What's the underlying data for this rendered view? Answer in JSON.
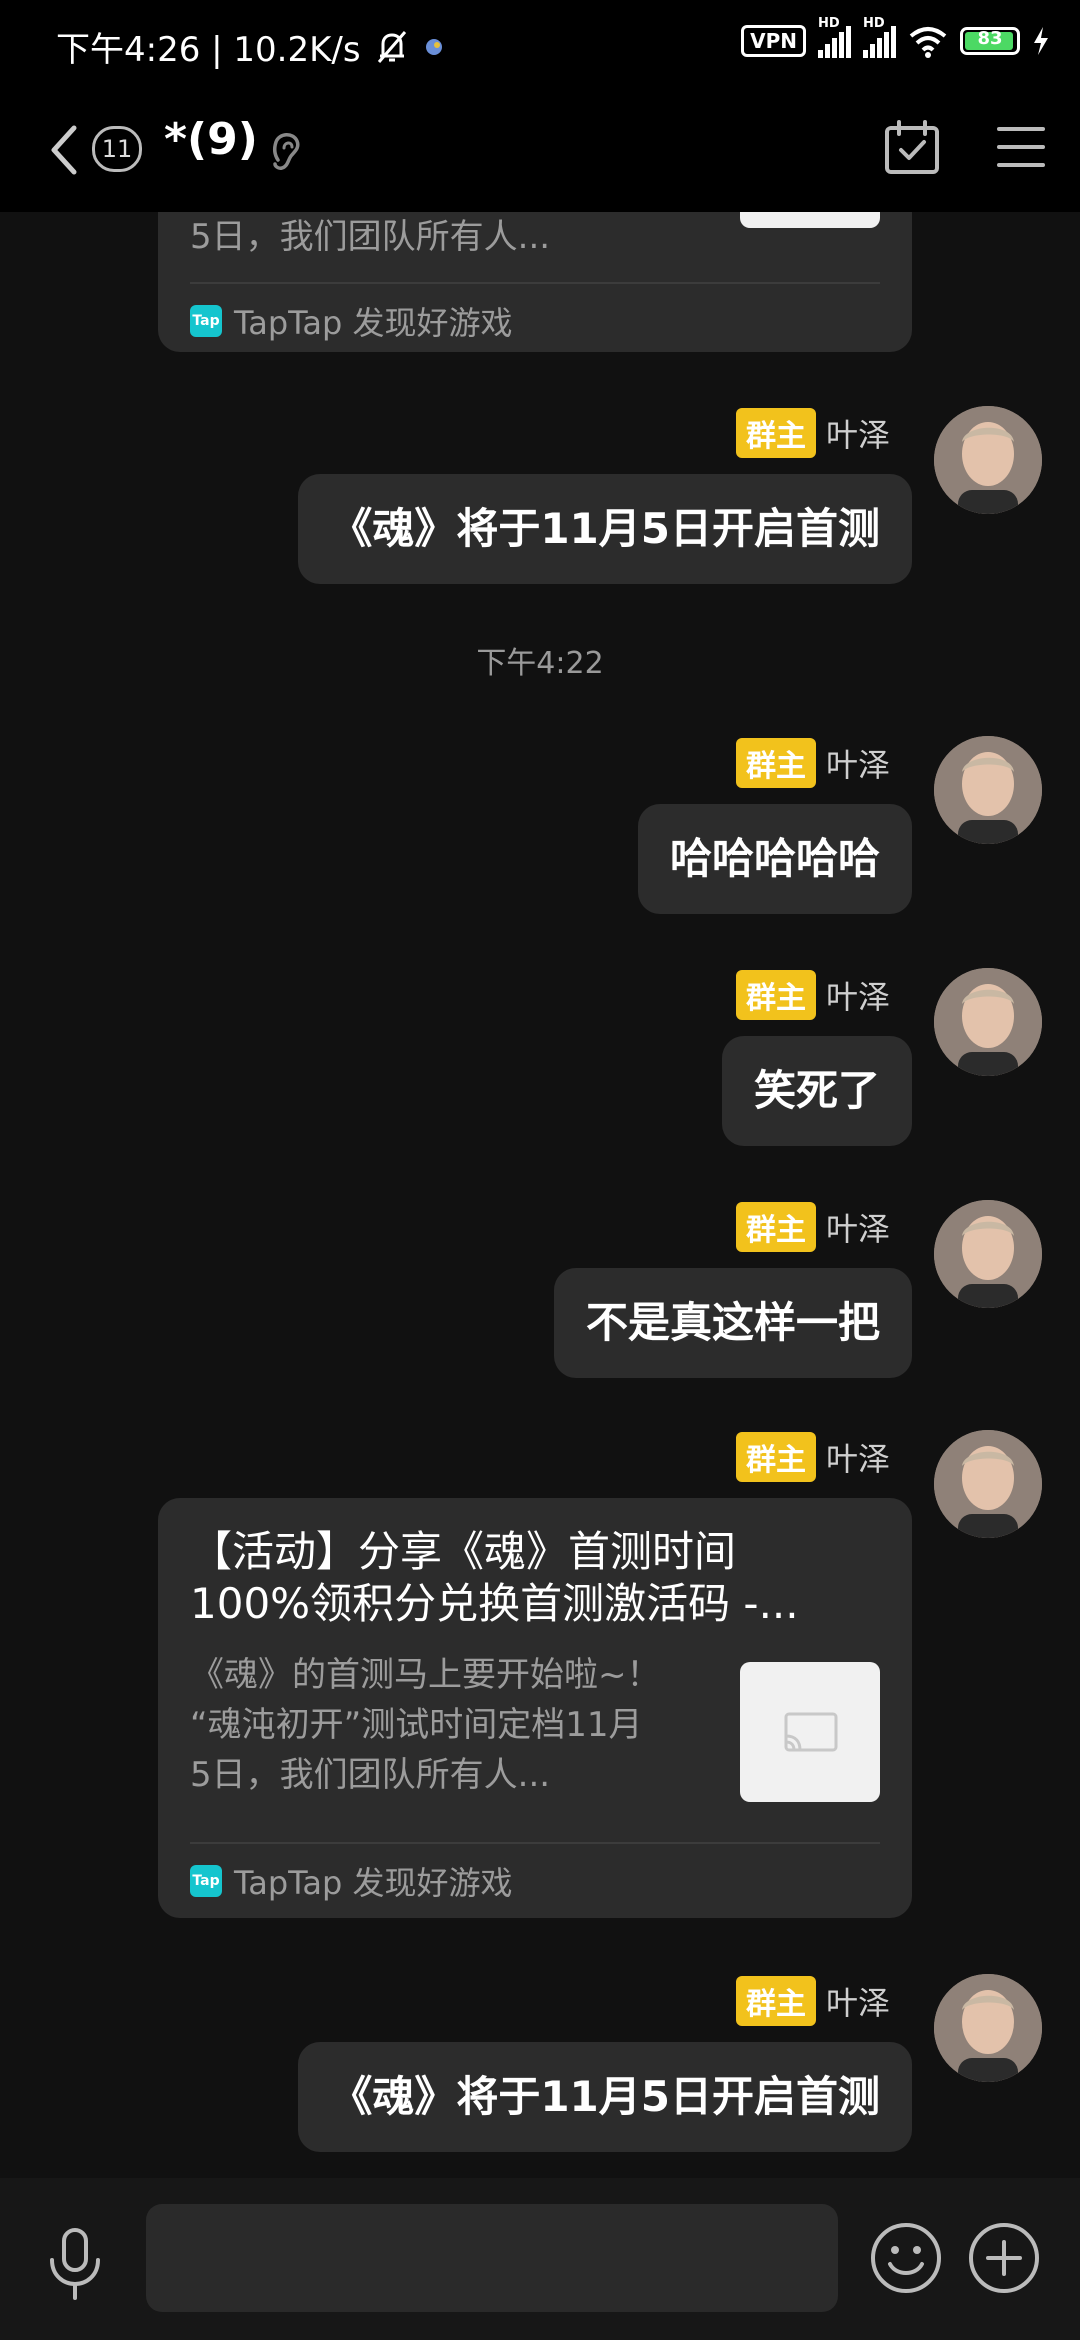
{
  "status_bar": {
    "time_speed": "下午4:26 | 10.2K/s",
    "vpn": "VPN",
    "hd1": "HD",
    "hd2": "HD",
    "battery": "83"
  },
  "nav": {
    "unread_count": "11",
    "title": "*(9)"
  },
  "messages": [
    {
      "type": "card_partial",
      "desc_tail": "5日，我们团队所有人...",
      "source": "TapTap 发现好游戏"
    },
    {
      "type": "text",
      "badge": "群主",
      "sender": "叶泽",
      "text": "《魂》将于11月5日开启首测"
    },
    {
      "type": "time",
      "text": "下午4:22"
    },
    {
      "type": "text",
      "badge": "群主",
      "sender": "叶泽",
      "text": "哈哈哈哈哈"
    },
    {
      "type": "text",
      "badge": "群主",
      "sender": "叶泽",
      "text": "笑死了"
    },
    {
      "type": "text",
      "badge": "群主",
      "sender": "叶泽",
      "text": "不是真这样一把"
    },
    {
      "type": "card",
      "badge": "群主",
      "sender": "叶泽",
      "title_line1": "【活动】分享《魂》首测时间",
      "title_line2": "100%领积分兑换首测激活码 -...",
      "desc_line1": "《魂》的首测马上要开始啦~！",
      "desc_line2": "“魂沌初开”测试时间定档11月",
      "desc_line3": "5日，我们团队所有人...",
      "source": "TapTap 发现好游戏"
    },
    {
      "type": "text",
      "badge": "群主",
      "sender": "叶泽",
      "text": "《魂》将于11月5日开启首测"
    }
  ],
  "logo_text": "Tap",
  "colors": {
    "owner_badge": "#f2c21c",
    "bubble": "#2c2c2c",
    "background": "#111111"
  }
}
